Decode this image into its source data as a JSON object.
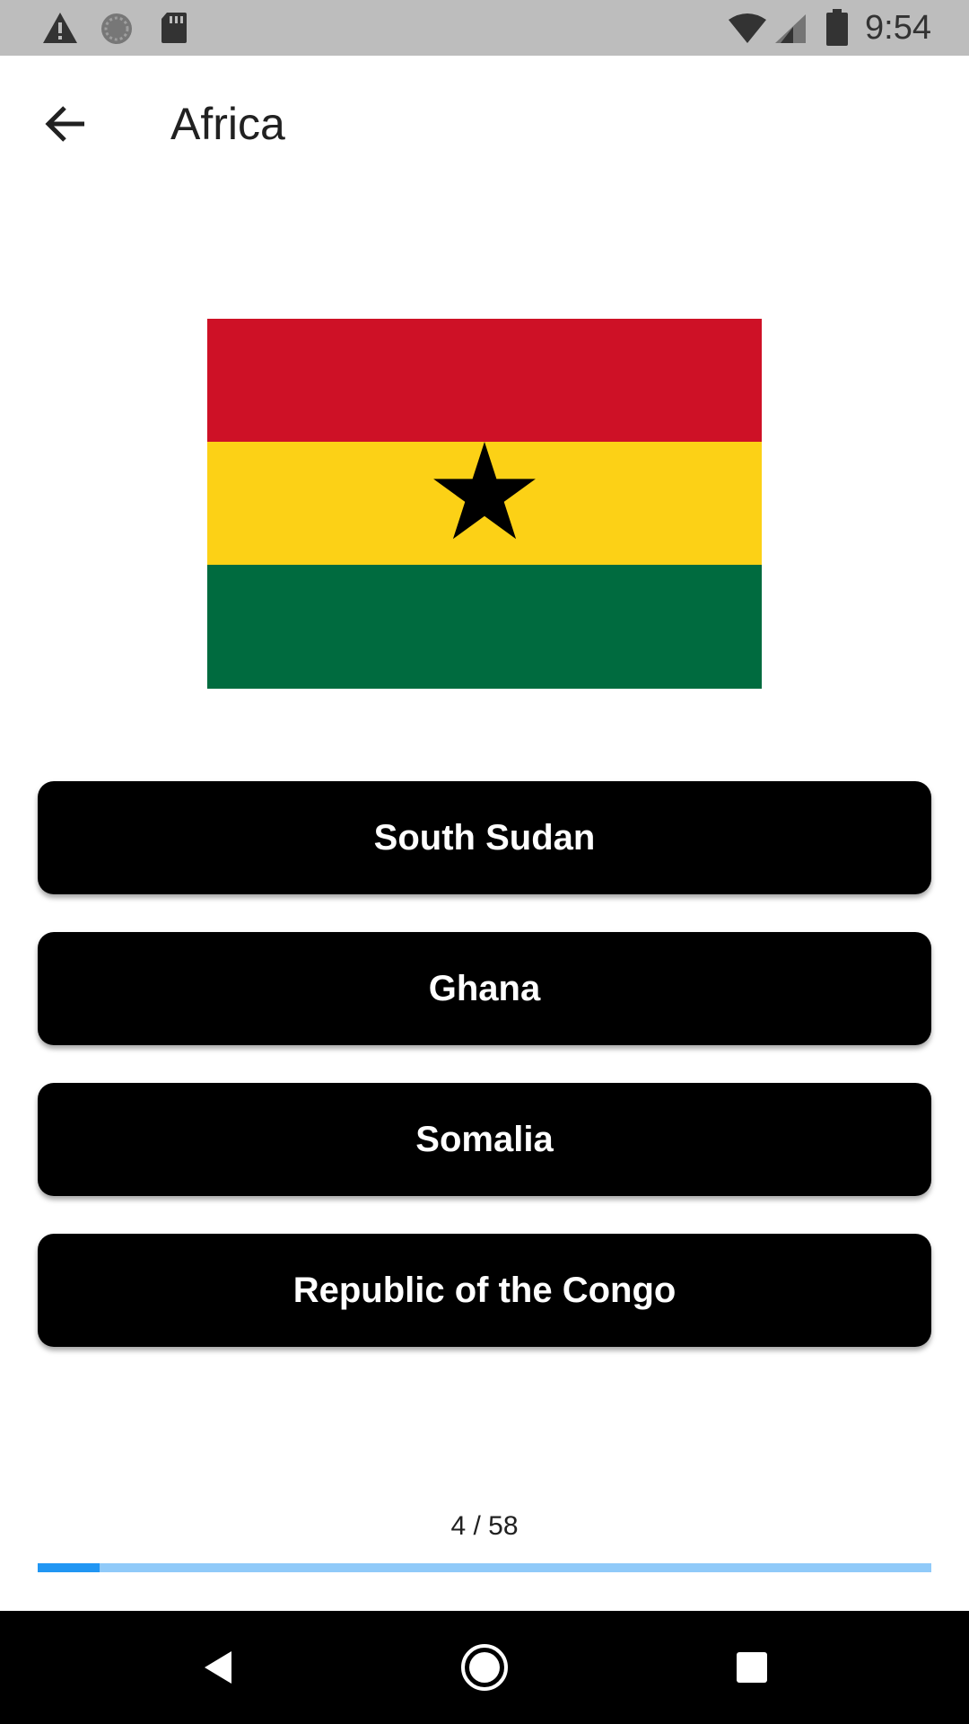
{
  "status_bar": {
    "time": "9:54",
    "icons_left": [
      "alert-icon",
      "sync-icon",
      "sd-card-icon"
    ],
    "icons_right": [
      "wifi-icon",
      "cell-signal-icon",
      "battery-icon"
    ]
  },
  "app_bar": {
    "title": "Africa",
    "back_icon": "arrow-left-icon"
  },
  "question": {
    "flag": "ghana-flag",
    "flag_colors": {
      "red": "#ce1126",
      "yellow": "#fcd116",
      "green": "#006b3f",
      "star": "#000000"
    }
  },
  "answers": [
    {
      "label": "South Sudan"
    },
    {
      "label": "Ghana"
    },
    {
      "label": "Somalia"
    },
    {
      "label": "Republic of the Congo"
    }
  ],
  "progress": {
    "text": "4 / 58",
    "current": 4,
    "total": 58,
    "fill_color": "#2196f3",
    "track_color": "#90caf9"
  },
  "nav_bar": {
    "buttons": [
      "back-triangle-icon",
      "home-circle-icon",
      "recents-square-icon"
    ]
  }
}
